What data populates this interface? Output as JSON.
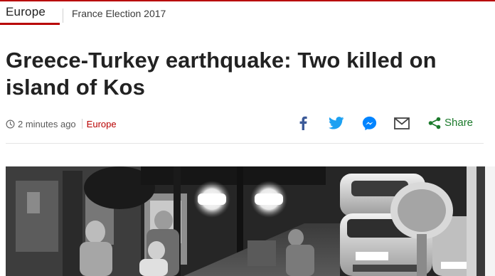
{
  "nav": {
    "current_section": "Europe",
    "secondary_link": "France Election 2017"
  },
  "article": {
    "headline": "Greece-Turkey earthquake: Two killed on island of Kos",
    "timestamp": "2 minutes ago",
    "section_link": "Europe"
  },
  "share": {
    "label": "Share",
    "icons": [
      "facebook-icon",
      "twitter-icon",
      "messenger-icon",
      "email-icon",
      "share-icon"
    ]
  },
  "colors": {
    "brand_red": "#b80000",
    "facebook_blue": "#3b5998",
    "twitter_blue": "#1da1f2",
    "messenger_blue": "#0084ff",
    "share_green": "#1c7a2c"
  },
  "image": {
    "description_icon": "cctv-photo"
  }
}
